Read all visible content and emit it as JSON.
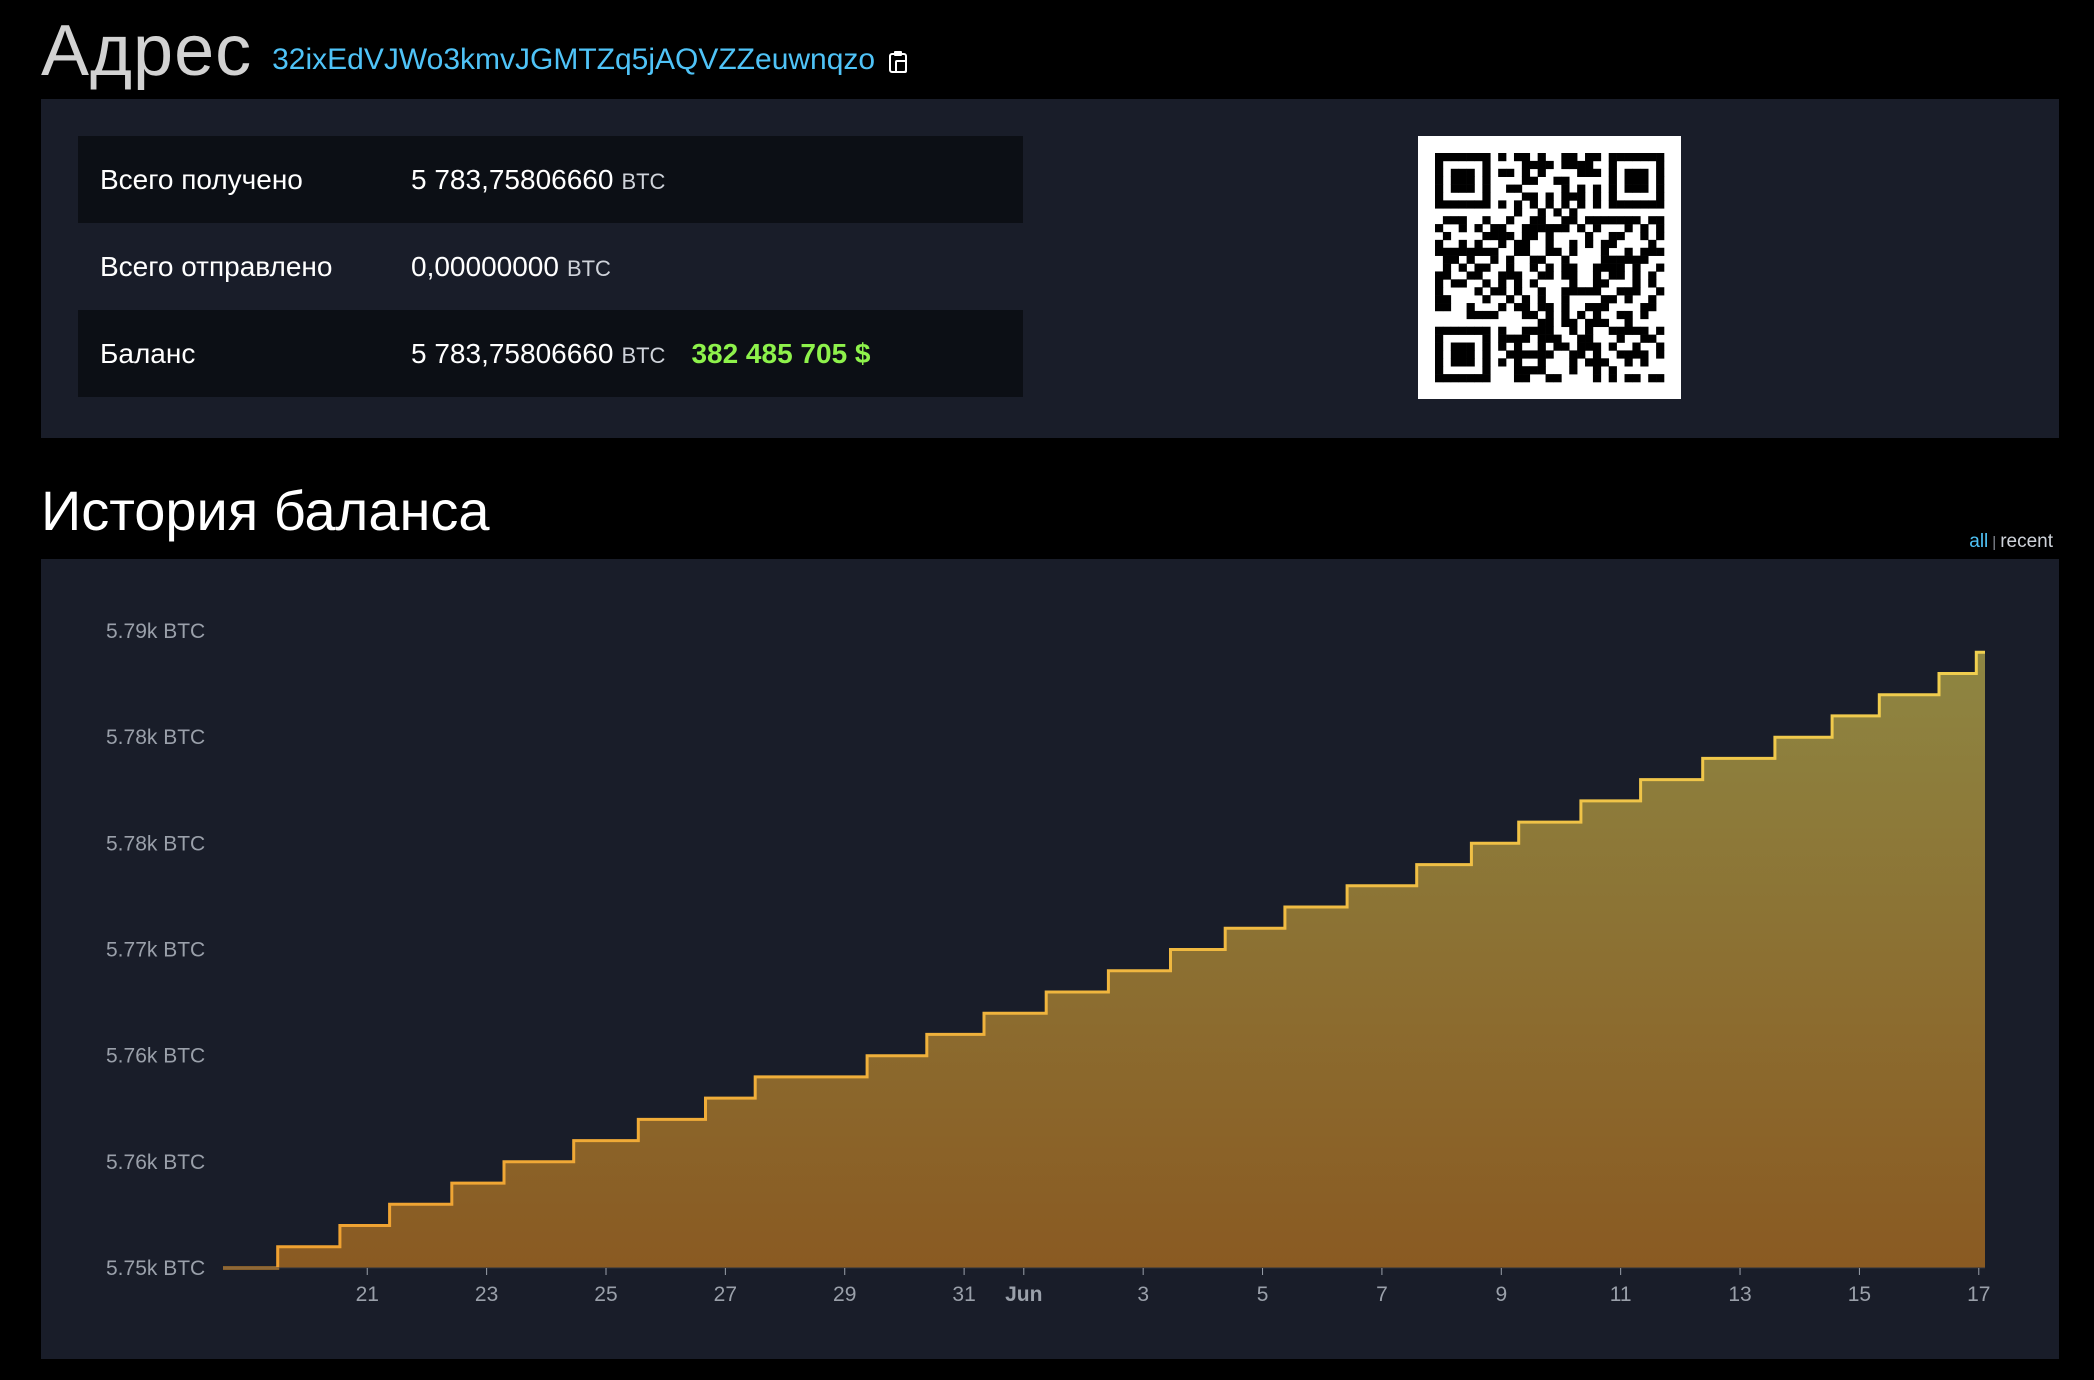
{
  "header": {
    "title": "Адрес",
    "address": "32ixEdVJWo3kmvJGMTZq5jAQVZZeuwnqzo",
    "copy_icon": "clipboard-icon"
  },
  "summary": {
    "rows": [
      {
        "label": "Всего получено",
        "value": "5 783,75806660",
        "unit": "BTC"
      },
      {
        "label": "Всего отправлено",
        "value": "0,00000000",
        "unit": "BTC"
      },
      {
        "label": "Баланс",
        "value": "5 783,75806660",
        "unit": "BTC",
        "usd": "382 485 705 $"
      }
    ],
    "qr_icon": "qr-code"
  },
  "history": {
    "title": "История баланса",
    "range_all": "all",
    "range_separator": "|",
    "range_recent": "recent",
    "active_range": "all"
  },
  "colors": {
    "background": "#000000",
    "panel": "#191d29",
    "accent_link": "#4fc3f7",
    "usd": "#8ef24b",
    "line_top": "#f0d050",
    "line_bottom": "#f0a030",
    "fill_top": "#8e8642",
    "fill_bottom": "#8a5a22"
  },
  "chart_data": {
    "type": "area",
    "step": true,
    "ytick_labels": [
      "5.79k BTC",
      "5.78k BTC",
      "5.78k BTC",
      "5.77k BTC",
      "5.76k BTC",
      "5.76k BTC",
      "5.75k BTC"
    ],
    "yticks": [
      5790,
      5785,
      5780,
      5775,
      5770,
      5765,
      5760
    ],
    "ylim": [
      5760,
      5790
    ],
    "xtick_labels": [
      "21",
      "23",
      "25",
      "27",
      "29",
      "31",
      "Jun",
      "3",
      "5",
      "7",
      "9",
      "11",
      "13",
      "15",
      "17"
    ],
    "xticks": [
      "2024-05-21",
      "2024-05-23",
      "2024-05-25",
      "2024-05-27",
      "2024-05-29",
      "2024-05-31",
      "2024-06-01",
      "2024-06-03",
      "2024-06-05",
      "2024-06-07",
      "2024-06-09",
      "2024-06-11",
      "2024-06-13",
      "2024-06-15",
      "2024-06-17"
    ],
    "bold_xticks": [
      "Jun"
    ],
    "grid": false,
    "series": [
      {
        "x": [
          "2024-05-19T02:00",
          "2024-05-20T00:00",
          "2024-05-21T01:00",
          "2024-05-21T21:00",
          "2024-05-22T22:00",
          "2024-05-23T19:00",
          "2024-05-24T23:00",
          "2024-05-26T01:00",
          "2024-05-27T04:00",
          "2024-05-28T00:00",
          "2024-05-29T21:00",
          "2024-05-30T21:00",
          "2024-05-31T20:00",
          "2024-06-01T21:00",
          "2024-06-02T22:00",
          "2024-06-03T23:00",
          "2024-06-04T21:00",
          "2024-06-05T21:00",
          "2024-06-06T22:00",
          "2024-06-08T02:00",
          "2024-06-09T00:00",
          "2024-06-09T19:00",
          "2024-06-10T20:00",
          "2024-06-11T20:00",
          "2024-06-12T21:00",
          "2024-06-14T02:00",
          "2024-06-15T01:00",
          "2024-06-15T20:00",
          "2024-06-16T20:00",
          "2024-06-17T11:00"
        ],
        "y": [
          5760.0,
          5761.0,
          5762.0,
          5763.0,
          5764.0,
          5765.0,
          5766.0,
          5767.0,
          5768.0,
          5769.0,
          5770.0,
          5771.0,
          5772.0,
          5773.0,
          5774.0,
          5775.0,
          5776.0,
          5777.0,
          5778.0,
          5779.0,
          5780.0,
          5781.0,
          5782.0,
          5783.0,
          5784.0,
          5785.0,
          5786.0,
          5787.0,
          5788.0,
          5789.0
        ]
      }
    ]
  }
}
